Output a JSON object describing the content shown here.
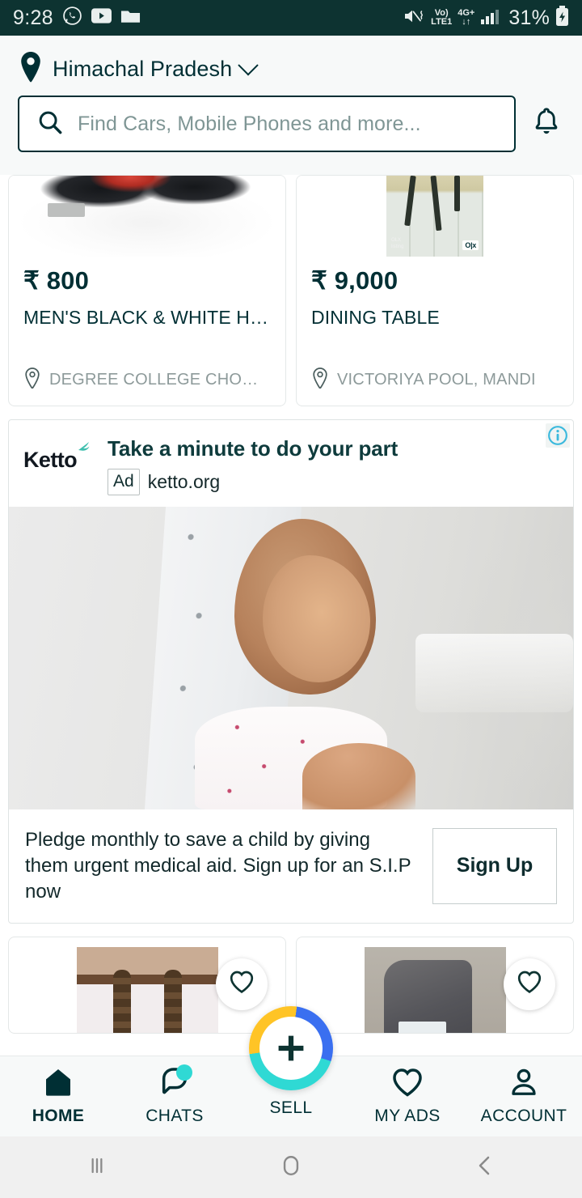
{
  "status_bar": {
    "time": "9:28",
    "left_icons": [
      "whatsapp-icon",
      "youtube-icon",
      "folder-icon"
    ],
    "volte_top": "Vo)",
    "volte_bottom": "LTE1",
    "network_top": "4G+",
    "network_bottom": "↓↑",
    "battery_percent": "31%",
    "right_icons": [
      "mute-vibrate-icon",
      "signal-bars-icon",
      "battery-charging-icon"
    ],
    "background_color": "#0d3331"
  },
  "header": {
    "location_label": "Himachal Pradesh",
    "location_icon": "map-pin-icon",
    "chevron_icon": "chevron-down-icon",
    "search_placeholder": "Find Cars, Mobile Phones and more...",
    "search_value": "",
    "search_icon": "search-icon",
    "notification_icon": "bell-icon",
    "background_color": "#f7f9f9"
  },
  "listings_top": [
    {
      "price": "₹ 800",
      "title": "MEN'S BLACK & WHITE HIGH...",
      "location": "DEGREE COLLEGE CHOWK, HA...",
      "location_icon": "map-pin-icon"
    },
    {
      "price": "₹ 9,000",
      "title": "DINING TABLE",
      "location": "VICTORIYA POOL, MANDI",
      "location_icon": "map-pin-icon",
      "watermark": "O|x"
    }
  ],
  "ad": {
    "advertiser": "Ketto",
    "logo_icon": "ketto-bird-icon",
    "headline": "Take a minute to do your part",
    "ad_badge": "Ad",
    "domain": "ketto.org",
    "adchoices_icon": "info-circle-icon",
    "description": "Pledge monthly to save a child by giving them urgent medical aid. Sign up for an S.I.P now",
    "cta_label": "Sign Up",
    "image_alt": "child-patient-photo"
  },
  "listings_bottom": [
    {
      "favorite_icon": "heart-icon",
      "image_alt": "crochet-craft-photo"
    },
    {
      "favorite_icon": "heart-icon",
      "image_alt": "scooter-photo"
    }
  ],
  "bottom_nav": {
    "items": [
      {
        "label": "HOME",
        "icon": "home-icon",
        "active": true
      },
      {
        "label": "CHATS",
        "icon": "chat-bubble-icon",
        "badge": true
      },
      {
        "label": "SELL",
        "icon": "plus-icon"
      },
      {
        "label": "MY ADS",
        "icon": "heart-icon"
      },
      {
        "label": "ACCOUNT",
        "icon": "person-icon"
      }
    ],
    "accent_colors": {
      "teal": "#2fd9d4",
      "yellow": "#ffc426",
      "blue": "#3a6ff0",
      "dark": "#002f34"
    }
  },
  "android_nav": {
    "recents_icon": "recents-icon",
    "home_icon": "home-circle-icon",
    "back_icon": "back-chevron-icon"
  }
}
